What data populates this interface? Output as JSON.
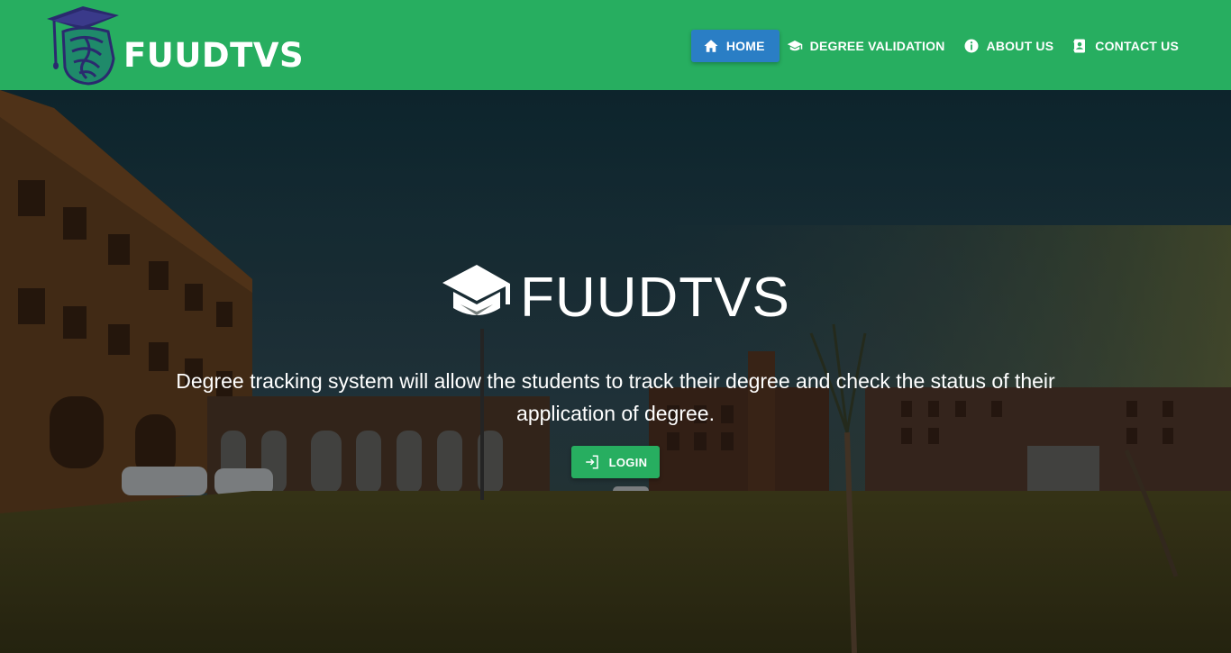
{
  "brand": {
    "name": "FUUDTVS",
    "logo_icon": "graduation-cap-logo"
  },
  "nav": {
    "items": [
      {
        "label": "HOME",
        "icon": "home-icon",
        "active": true
      },
      {
        "label": "DEGREE VALIDATION",
        "icon": "graduation-cap-icon",
        "active": false
      },
      {
        "label": "ABOUT US",
        "icon": "info-icon",
        "active": false
      },
      {
        "label": "CONTACT US",
        "icon": "contact-card-icon",
        "active": false
      }
    ]
  },
  "hero": {
    "title": "FUUDTVS",
    "title_icon": "graduation-cap-icon",
    "description": "Degree tracking system will allow the students to track their degree and check the status of their application of degree.",
    "login_label": "LOGIN",
    "login_icon": "login-icon"
  },
  "colors": {
    "header_bg": "#27ae60",
    "active_nav_bg": "#2a7ec5",
    "button_bg": "#27ae60",
    "text": "#ffffff",
    "logo_navy": "#2a2a6e"
  }
}
